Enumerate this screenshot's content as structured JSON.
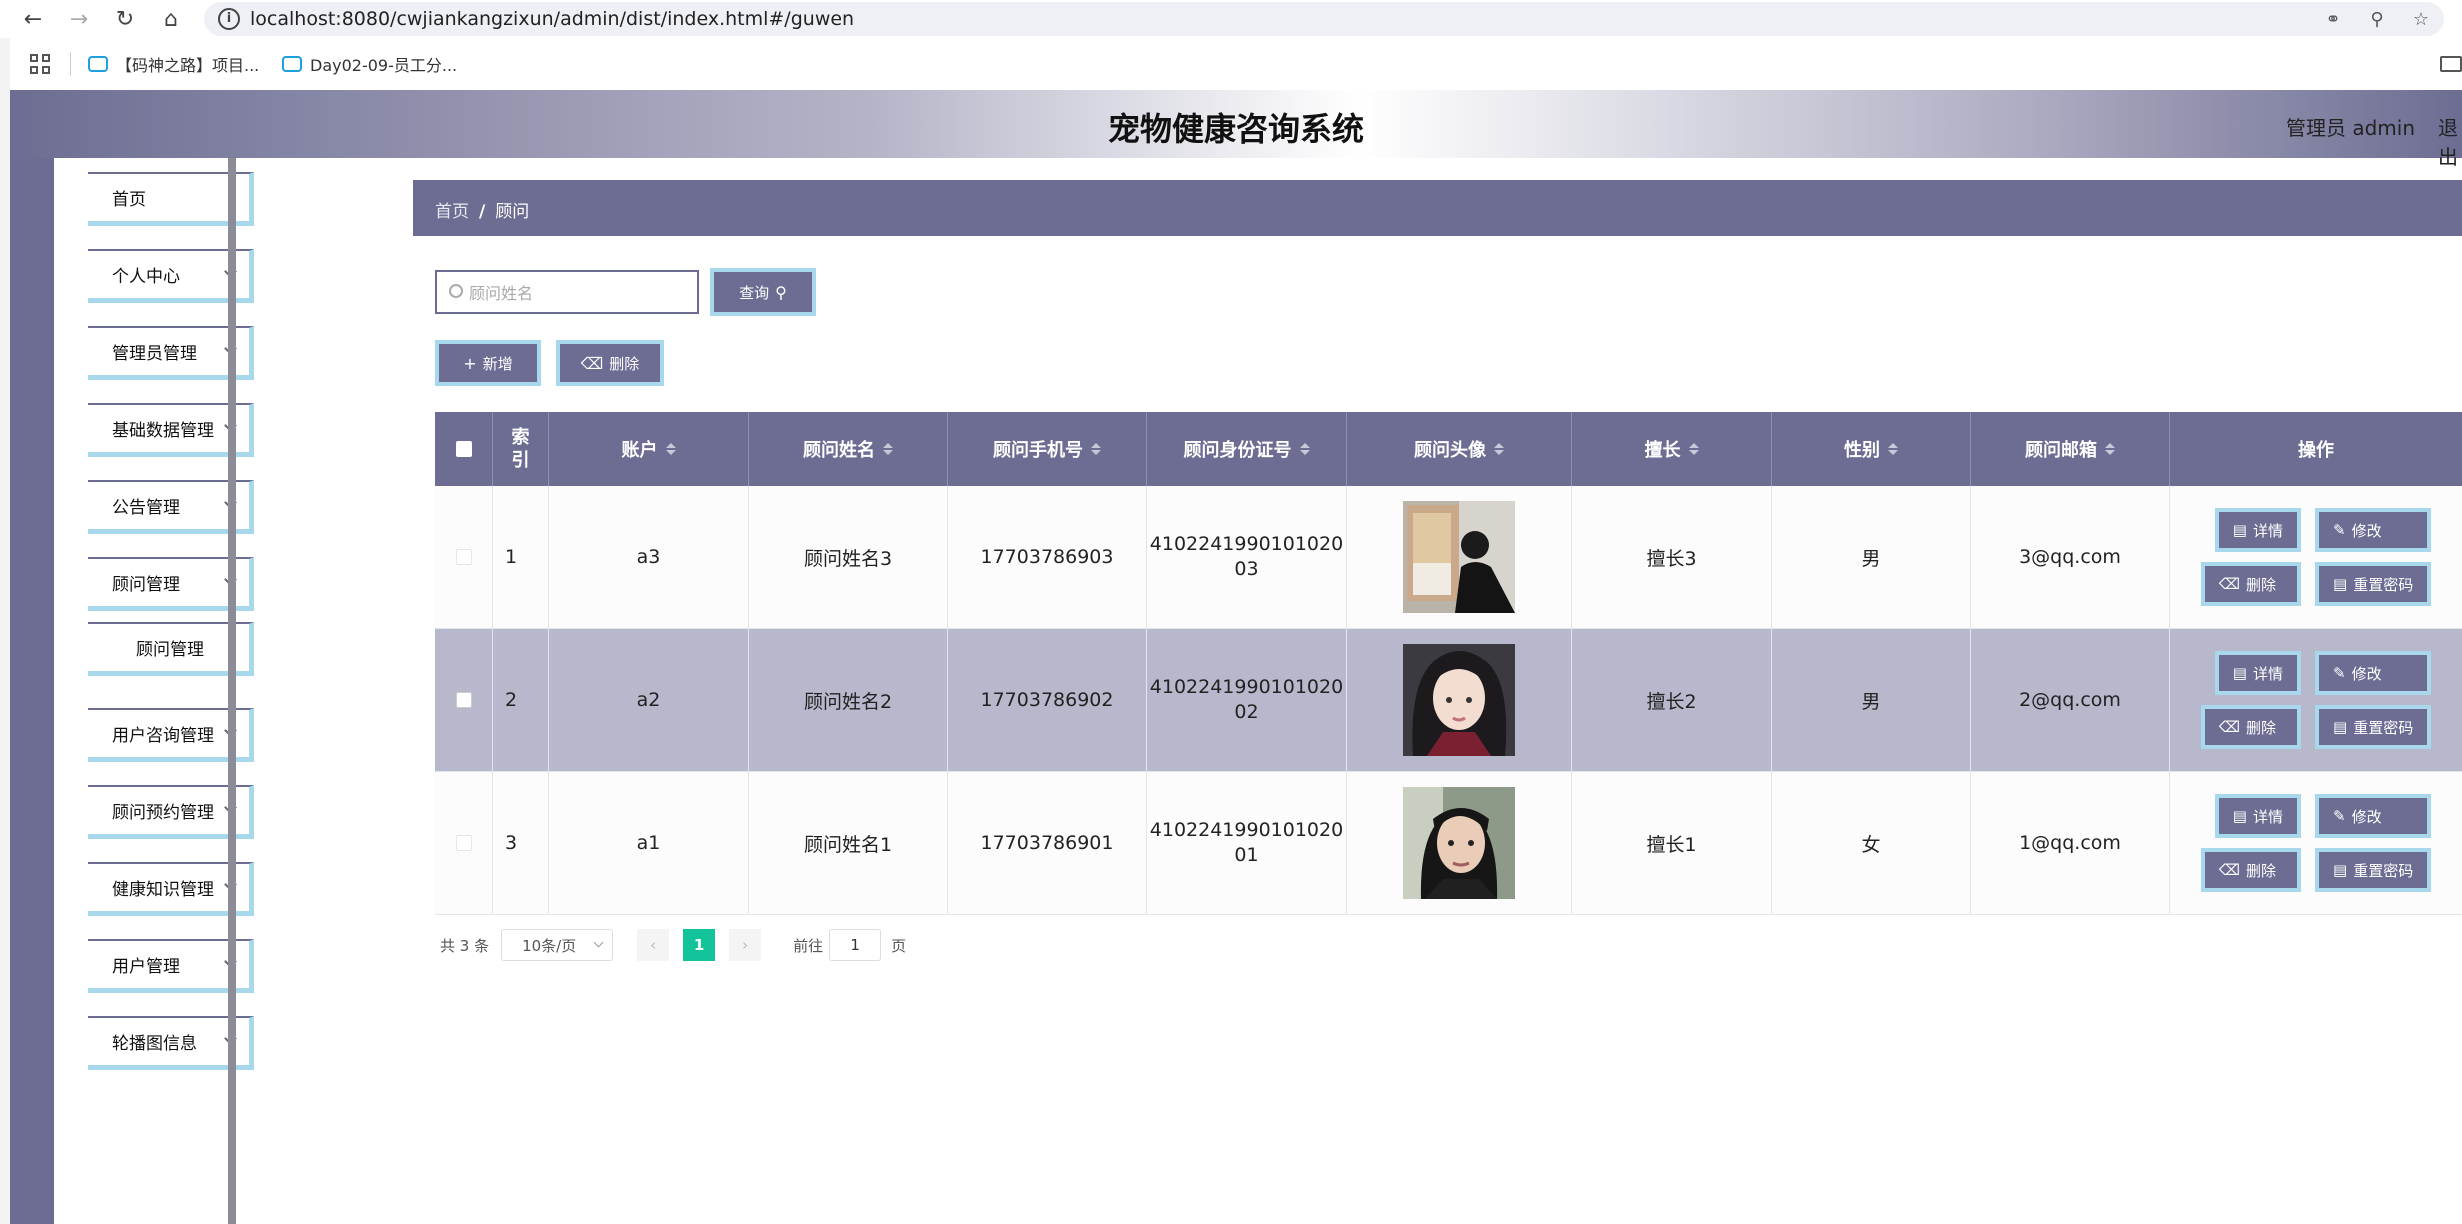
{
  "browser": {
    "url": "localhost:8080/cwjiankangzixun/admin/dist/index.html#/guwen",
    "bookmarks": [
      "【码神之路】项目...",
      "Day02-09-员工分..."
    ]
  },
  "header": {
    "title": "宠物健康咨询系统",
    "user": "管理员 admin",
    "logout": "退出"
  },
  "sidebar": {
    "items": [
      {
        "label": "首页"
      },
      {
        "label": "个人中心"
      },
      {
        "label": "管理员管理"
      },
      {
        "label": "基础数据管理"
      },
      {
        "label": "公告管理"
      },
      {
        "label": "顾问管理"
      },
      {
        "label": "顾问管理"
      },
      {
        "label": "用户咨询管理"
      },
      {
        "label": "顾问预约管理"
      },
      {
        "label": "健康知识管理"
      },
      {
        "label": "用户管理"
      },
      {
        "label": "轮播图信息"
      }
    ]
  },
  "breadcrumb": {
    "home": "首页",
    "separator": "/",
    "current": "顾问"
  },
  "search": {
    "placeholder": "顾问姓名",
    "value": "",
    "button": "查询"
  },
  "actions": {
    "add": "新增",
    "delete": "删除"
  },
  "table": {
    "columns": [
      "索引",
      "账户",
      "顾问姓名",
      "顾问手机号",
      "顾问身份证号",
      "顾问头像",
      "擅长",
      "性别",
      "顾问邮箱",
      "操作"
    ],
    "rows": [
      {
        "index": "1",
        "account": "a3",
        "name": "顾问姓名3",
        "phone": "17703786903",
        "idcard": "410224199010102003",
        "idcard_l1": "4102241990101020",
        "idcard_l2": "03",
        "skill": "擅长3",
        "gender": "男",
        "email": "3@qq.com"
      },
      {
        "index": "2",
        "account": "a2",
        "name": "顾问姓名2",
        "phone": "17703786902",
        "idcard": "410224199010102002",
        "idcard_l1": "4102241990101020",
        "idcard_l2": "02",
        "skill": "擅长2",
        "gender": "男",
        "email": "2@qq.com"
      },
      {
        "index": "3",
        "account": "a1",
        "name": "顾问姓名1",
        "phone": "17703786901",
        "idcard": "410224199010102001",
        "idcard_l1": "4102241990101020",
        "idcard_l2": "01",
        "skill": "擅长1",
        "gender": "女",
        "email": "1@qq.com"
      }
    ],
    "row_actions": {
      "detail": "详情",
      "edit": "修改",
      "delete": "删除",
      "reset": "重置密码"
    }
  },
  "pagination": {
    "total": "共 3 条",
    "page_size": "10条/页",
    "current": "1",
    "goto_prefix": "前往",
    "goto_value": "1",
    "goto_suffix": "页"
  },
  "colors": {
    "theme": "#6d6d93",
    "accent_border": "#a8d8ec",
    "pager_active": "#13c39a",
    "row_highlight": "#b8b8cc"
  }
}
